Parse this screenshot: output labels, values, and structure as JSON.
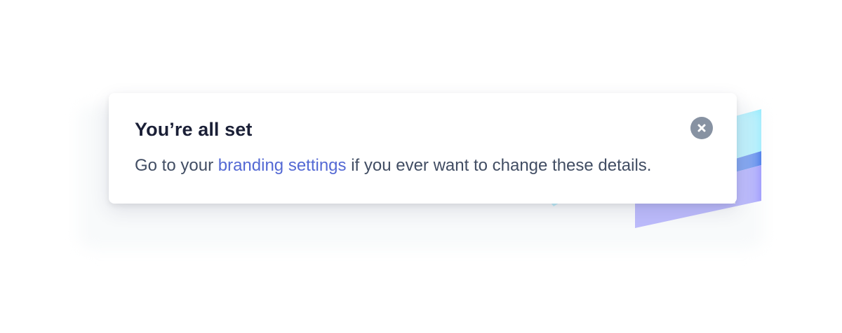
{
  "toast": {
    "title": "You’re all set",
    "message_before": "Go to your ",
    "link_text": "branding settings",
    "message_after": " if you ever want to change these details.",
    "close_icon": "close-icon"
  },
  "colors": {
    "title": "#1a1f36",
    "body_text": "#414d63",
    "link": "#5469d4",
    "close_button": "#8792a2",
    "accent_cyan": "#80e9ff",
    "accent_blue": "#0048e5",
    "accent_purple": "#7a73ff"
  }
}
